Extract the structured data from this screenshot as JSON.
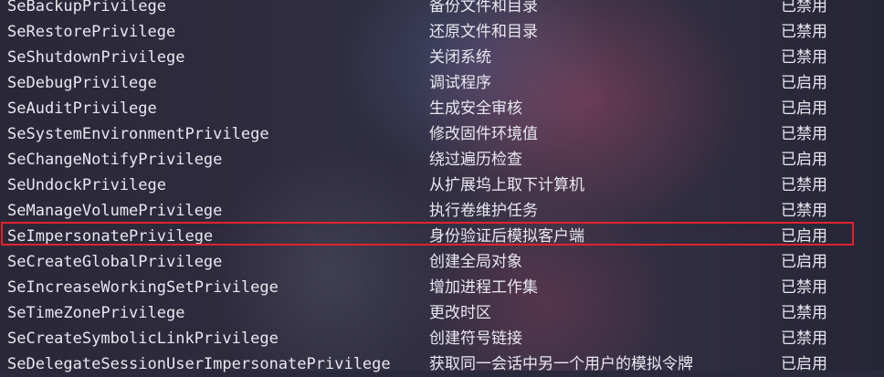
{
  "privileges": [
    {
      "name": "SeBackupPrivilege",
      "description": "备份文件和目录",
      "state": "已禁用"
    },
    {
      "name": "SeRestorePrivilege",
      "description": "还原文件和目录",
      "state": "已禁用"
    },
    {
      "name": "SeShutdownPrivilege",
      "description": "关闭系统",
      "state": "已禁用"
    },
    {
      "name": "SeDebugPrivilege",
      "description": "调试程序",
      "state": "已启用"
    },
    {
      "name": "SeAuditPrivilege",
      "description": "生成安全审核",
      "state": "已启用"
    },
    {
      "name": "SeSystemEnvironmentPrivilege",
      "description": "修改固件环境值",
      "state": "已禁用"
    },
    {
      "name": "SeChangeNotifyPrivilege",
      "description": "绕过遍历检查",
      "state": "已启用"
    },
    {
      "name": "SeUndockPrivilege",
      "description": "从扩展坞上取下计算机",
      "state": "已禁用"
    },
    {
      "name": "SeManageVolumePrivilege",
      "description": "执行卷维护任务",
      "state": "已禁用"
    },
    {
      "name": "SeImpersonatePrivilege",
      "description": "身份验证后模拟客户端",
      "state": "已启用"
    },
    {
      "name": "SeCreateGlobalPrivilege",
      "description": "创建全局对象",
      "state": "已启用"
    },
    {
      "name": "SeIncreaseWorkingSetPrivilege",
      "description": "增加进程工作集",
      "state": "已禁用"
    },
    {
      "name": "SeTimeZonePrivilege",
      "description": "更改时区",
      "state": "已禁用"
    },
    {
      "name": "SeCreateSymbolicLinkPrivilege",
      "description": "创建符号链接",
      "state": "已禁用"
    },
    {
      "name": "SeDelegateSessionUserImpersonatePrivilege",
      "description": "获取同一会话中另一个用户的模拟令牌",
      "state": "已启用"
    }
  ],
  "colors": {
    "text": "#e8e8f0",
    "highlight_border": "#e0242b"
  }
}
